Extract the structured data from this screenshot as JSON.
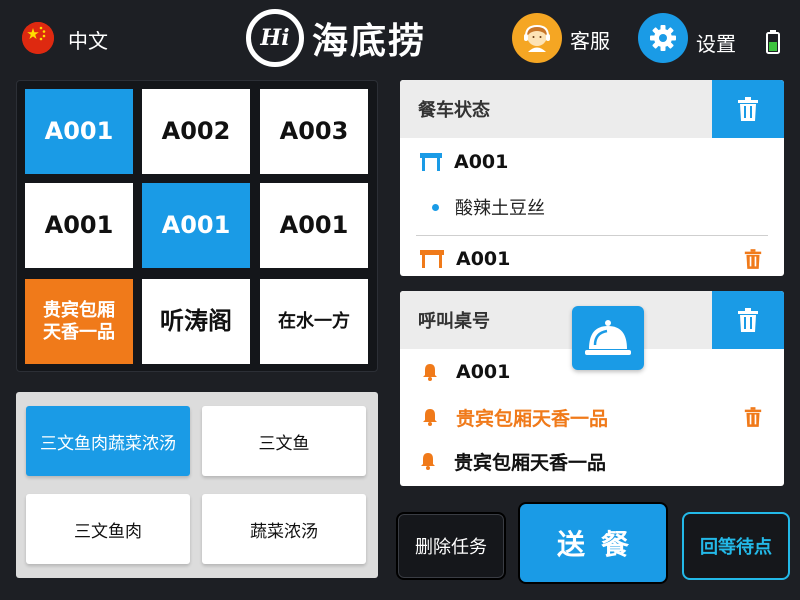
{
  "header": {
    "language": "中文",
    "logo_mark": "Hi",
    "logo_text": "海底捞",
    "service_label": "客服",
    "settings_label": "设置"
  },
  "tables": [
    {
      "label": "A001",
      "state": "selected"
    },
    {
      "label": "A002",
      "state": "normal"
    },
    {
      "label": "A003",
      "state": "normal"
    },
    {
      "label": "A001",
      "state": "normal"
    },
    {
      "label": "A001",
      "state": "selected"
    },
    {
      "label": "A001",
      "state": "normal"
    },
    {
      "label": "贵宾包厢天香一品",
      "state": "vip"
    },
    {
      "label": "听涛阁",
      "state": "normal"
    },
    {
      "label": "在水一方",
      "state": "normal"
    }
  ],
  "dishes": [
    {
      "label": "三文鱼肉蔬菜浓汤",
      "state": "selected"
    },
    {
      "label": "三文鱼",
      "state": "normal"
    },
    {
      "label": "三文鱼肉",
      "state": "normal"
    },
    {
      "label": "蔬菜浓汤",
      "state": "normal"
    }
  ],
  "cart_status": {
    "title": "餐车状态",
    "entries": [
      {
        "table": "A001",
        "icon": "table-icon",
        "color": "#1a9be6"
      },
      {
        "dish": "酸辣土豆丝"
      },
      {
        "table": "A001",
        "icon": "table-icon",
        "color": "#f07a1a"
      }
    ]
  },
  "call_table": {
    "title": "呼叫桌号",
    "entries": [
      {
        "label": "A001",
        "color": "#111111"
      },
      {
        "label": "贵宾包厢天香一品",
        "color": "#f07a1a"
      },
      {
        "label": "贵宾包厢天香一品",
        "color": "#111111"
      }
    ]
  },
  "buttons": {
    "delete_task": "删除任务",
    "send": "送餐",
    "return": "回等待点"
  },
  "colors": {
    "accent_blue": "#1a9be6",
    "accent_orange": "#f07a1a",
    "accent_cyan": "#23b9e8",
    "background": "#1d1f24"
  }
}
